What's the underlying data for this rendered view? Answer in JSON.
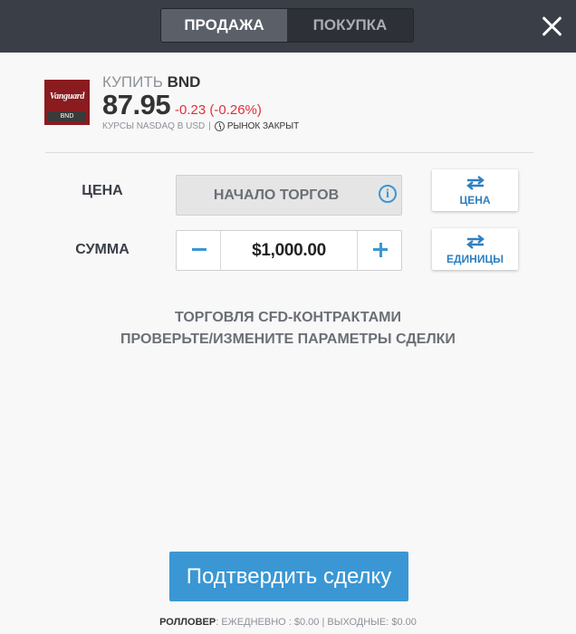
{
  "tabs": {
    "sell": "ПРОДАЖА",
    "buy": "ПОКУПКА",
    "active": "sell"
  },
  "instrument": {
    "logo_brand": "Vanguard",
    "logo_ticker": "BND",
    "title_prefix": "КУПИТЬ",
    "symbol": "BND",
    "price": "87.95",
    "change": "-0.23 (-0.26%)",
    "quotes_source": "КУРСЫ NASDAQ В USD",
    "separator": "|",
    "market_status": "РЫНОК ЗАКРЫТ"
  },
  "form": {
    "price_label": "ЦЕНА",
    "price_value": "НАЧАЛО ТОРГОВ",
    "amount_label": "СУММА",
    "amount_value": "$1,000.00",
    "price_toggle_label": "ЦЕНА",
    "units_toggle_label": "ЕДИНИЦЫ"
  },
  "notice": {
    "line1": "ТОРГОВЛЯ CFD-КОНТРАКТАМИ",
    "line2": "ПРОВЕРЬТЕ/ИЗМЕНИТЕ ПАРАМЕТРЫ СДЕЛКИ"
  },
  "confirm_label": "Подтвердить сделку",
  "rollover": {
    "label": "РОЛЛОВЕР",
    "daily": ": ЕЖЕДНЕВНО : $0.00",
    "separator": " | ",
    "weekend": "ВЫХОДНЫЕ: $0.00"
  },
  "icons": [
    "close-icon",
    "info-icon",
    "swap-arrows-icon",
    "minus-icon",
    "plus-icon",
    "clock-icon"
  ],
  "colors": {
    "accent": "#3a97d4",
    "negative": "#e0303b",
    "header_bg": "#3a3e46",
    "brand": "#8a1b1f"
  }
}
